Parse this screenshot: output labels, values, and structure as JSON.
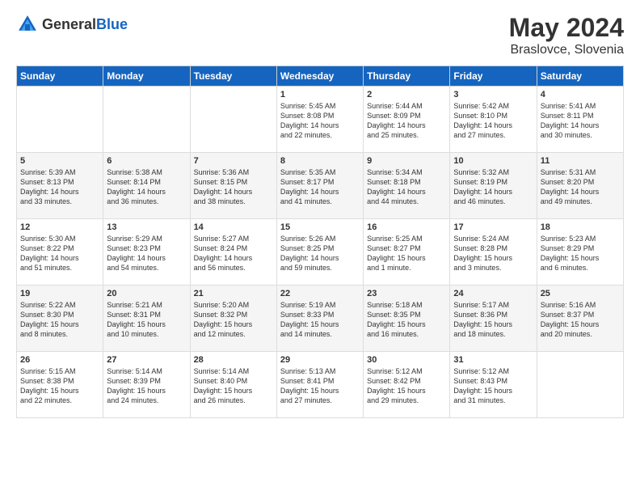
{
  "header": {
    "logo_general": "General",
    "logo_blue": "Blue",
    "title": "May 2024",
    "subtitle": "Braslovce, Slovenia"
  },
  "weekdays": [
    "Sunday",
    "Monday",
    "Tuesday",
    "Wednesday",
    "Thursday",
    "Friday",
    "Saturday"
  ],
  "weeks": [
    [
      {
        "day": "",
        "info": ""
      },
      {
        "day": "",
        "info": ""
      },
      {
        "day": "",
        "info": ""
      },
      {
        "day": "1",
        "info": "Sunrise: 5:45 AM\nSunset: 8:08 PM\nDaylight: 14 hours\nand 22 minutes."
      },
      {
        "day": "2",
        "info": "Sunrise: 5:44 AM\nSunset: 8:09 PM\nDaylight: 14 hours\nand 25 minutes."
      },
      {
        "day": "3",
        "info": "Sunrise: 5:42 AM\nSunset: 8:10 PM\nDaylight: 14 hours\nand 27 minutes."
      },
      {
        "day": "4",
        "info": "Sunrise: 5:41 AM\nSunset: 8:11 PM\nDaylight: 14 hours\nand 30 minutes."
      }
    ],
    [
      {
        "day": "5",
        "info": "Sunrise: 5:39 AM\nSunset: 8:13 PM\nDaylight: 14 hours\nand 33 minutes."
      },
      {
        "day": "6",
        "info": "Sunrise: 5:38 AM\nSunset: 8:14 PM\nDaylight: 14 hours\nand 36 minutes."
      },
      {
        "day": "7",
        "info": "Sunrise: 5:36 AM\nSunset: 8:15 PM\nDaylight: 14 hours\nand 38 minutes."
      },
      {
        "day": "8",
        "info": "Sunrise: 5:35 AM\nSunset: 8:17 PM\nDaylight: 14 hours\nand 41 minutes."
      },
      {
        "day": "9",
        "info": "Sunrise: 5:34 AM\nSunset: 8:18 PM\nDaylight: 14 hours\nand 44 minutes."
      },
      {
        "day": "10",
        "info": "Sunrise: 5:32 AM\nSunset: 8:19 PM\nDaylight: 14 hours\nand 46 minutes."
      },
      {
        "day": "11",
        "info": "Sunrise: 5:31 AM\nSunset: 8:20 PM\nDaylight: 14 hours\nand 49 minutes."
      }
    ],
    [
      {
        "day": "12",
        "info": "Sunrise: 5:30 AM\nSunset: 8:22 PM\nDaylight: 14 hours\nand 51 minutes."
      },
      {
        "day": "13",
        "info": "Sunrise: 5:29 AM\nSunset: 8:23 PM\nDaylight: 14 hours\nand 54 minutes."
      },
      {
        "day": "14",
        "info": "Sunrise: 5:27 AM\nSunset: 8:24 PM\nDaylight: 14 hours\nand 56 minutes."
      },
      {
        "day": "15",
        "info": "Sunrise: 5:26 AM\nSunset: 8:25 PM\nDaylight: 14 hours\nand 59 minutes."
      },
      {
        "day": "16",
        "info": "Sunrise: 5:25 AM\nSunset: 8:27 PM\nDaylight: 15 hours\nand 1 minute."
      },
      {
        "day": "17",
        "info": "Sunrise: 5:24 AM\nSunset: 8:28 PM\nDaylight: 15 hours\nand 3 minutes."
      },
      {
        "day": "18",
        "info": "Sunrise: 5:23 AM\nSunset: 8:29 PM\nDaylight: 15 hours\nand 6 minutes."
      }
    ],
    [
      {
        "day": "19",
        "info": "Sunrise: 5:22 AM\nSunset: 8:30 PM\nDaylight: 15 hours\nand 8 minutes."
      },
      {
        "day": "20",
        "info": "Sunrise: 5:21 AM\nSunset: 8:31 PM\nDaylight: 15 hours\nand 10 minutes."
      },
      {
        "day": "21",
        "info": "Sunrise: 5:20 AM\nSunset: 8:32 PM\nDaylight: 15 hours\nand 12 minutes."
      },
      {
        "day": "22",
        "info": "Sunrise: 5:19 AM\nSunset: 8:33 PM\nDaylight: 15 hours\nand 14 minutes."
      },
      {
        "day": "23",
        "info": "Sunrise: 5:18 AM\nSunset: 8:35 PM\nDaylight: 15 hours\nand 16 minutes."
      },
      {
        "day": "24",
        "info": "Sunrise: 5:17 AM\nSunset: 8:36 PM\nDaylight: 15 hours\nand 18 minutes."
      },
      {
        "day": "25",
        "info": "Sunrise: 5:16 AM\nSunset: 8:37 PM\nDaylight: 15 hours\nand 20 minutes."
      }
    ],
    [
      {
        "day": "26",
        "info": "Sunrise: 5:15 AM\nSunset: 8:38 PM\nDaylight: 15 hours\nand 22 minutes."
      },
      {
        "day": "27",
        "info": "Sunrise: 5:14 AM\nSunset: 8:39 PM\nDaylight: 15 hours\nand 24 minutes."
      },
      {
        "day": "28",
        "info": "Sunrise: 5:14 AM\nSunset: 8:40 PM\nDaylight: 15 hours\nand 26 minutes."
      },
      {
        "day": "29",
        "info": "Sunrise: 5:13 AM\nSunset: 8:41 PM\nDaylight: 15 hours\nand 27 minutes."
      },
      {
        "day": "30",
        "info": "Sunrise: 5:12 AM\nSunset: 8:42 PM\nDaylight: 15 hours\nand 29 minutes."
      },
      {
        "day": "31",
        "info": "Sunrise: 5:12 AM\nSunset: 8:43 PM\nDaylight: 15 hours\nand 31 minutes."
      },
      {
        "day": "",
        "info": ""
      }
    ]
  ]
}
